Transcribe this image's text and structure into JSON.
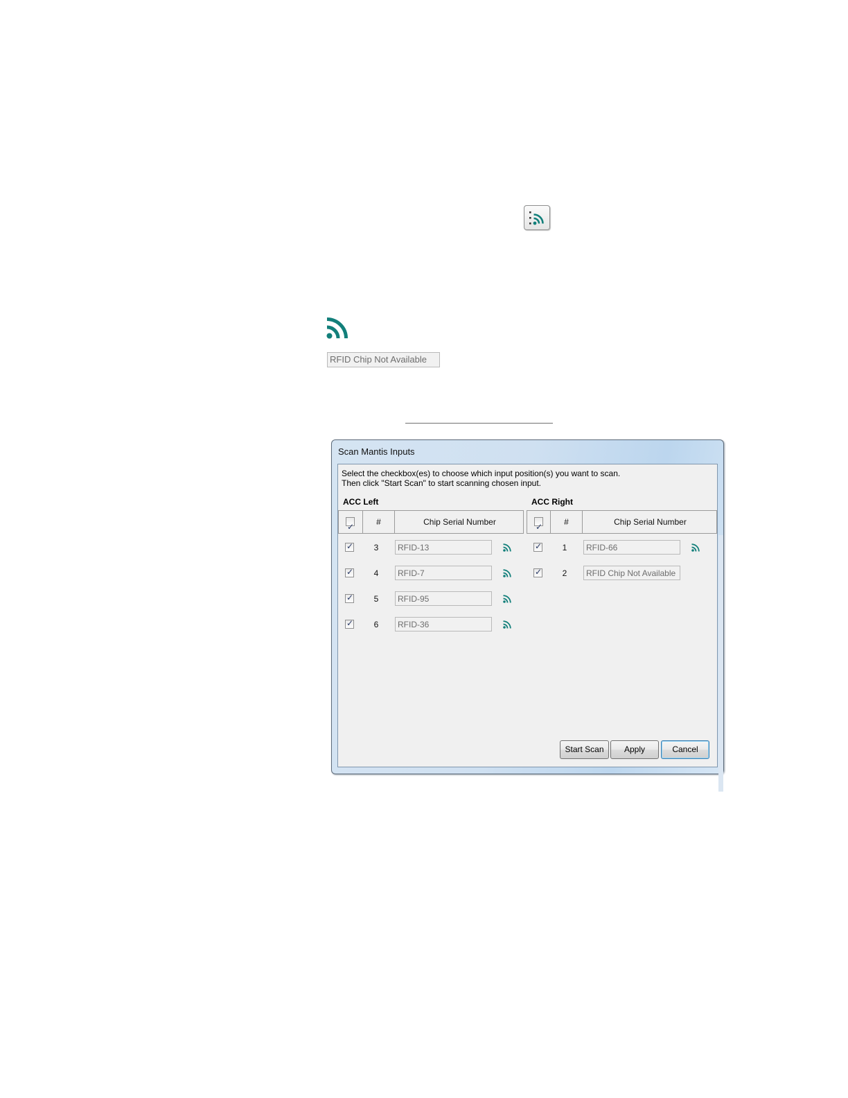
{
  "icons": {
    "scan_button_icon": "rss-scan-icon",
    "large_icon": "rss-icon",
    "row_icon": "rss-icon",
    "accent_color": "#127f7a"
  },
  "sample_field": {
    "value": "RFID Chip Not Available"
  },
  "dialog": {
    "title": "Scan Mantis Inputs",
    "instructions": [
      "Select the checkbox(es) to choose which input position(s) you want to scan.",
      "Then click \"Start Scan\" to start scanning chosen input."
    ],
    "left": {
      "section_label": "ACC Left",
      "columns": [
        "#",
        "Chip Serial Number"
      ],
      "select_all_checked": true,
      "rows": [
        {
          "checked": true,
          "number": "3",
          "serial": "RFID-13",
          "rfid_icon": true
        },
        {
          "checked": true,
          "number": "4",
          "serial": "RFID-7",
          "rfid_icon": true
        },
        {
          "checked": true,
          "number": "5",
          "serial": "RFID-95",
          "rfid_icon": true
        },
        {
          "checked": true,
          "number": "6",
          "serial": "RFID-36",
          "rfid_icon": true
        }
      ]
    },
    "right": {
      "section_label": "ACC Right",
      "columns": [
        "#",
        "Chip Serial Number"
      ],
      "select_all_checked": true,
      "rows": [
        {
          "checked": true,
          "number": "1",
          "serial": "RFID-66",
          "rfid_icon": true
        },
        {
          "checked": true,
          "number": "2",
          "serial": "RFID Chip Not Available",
          "rfid_icon": false
        }
      ]
    },
    "buttons": {
      "start_scan": "Start Scan",
      "apply": "Apply",
      "cancel": "Cancel"
    }
  }
}
